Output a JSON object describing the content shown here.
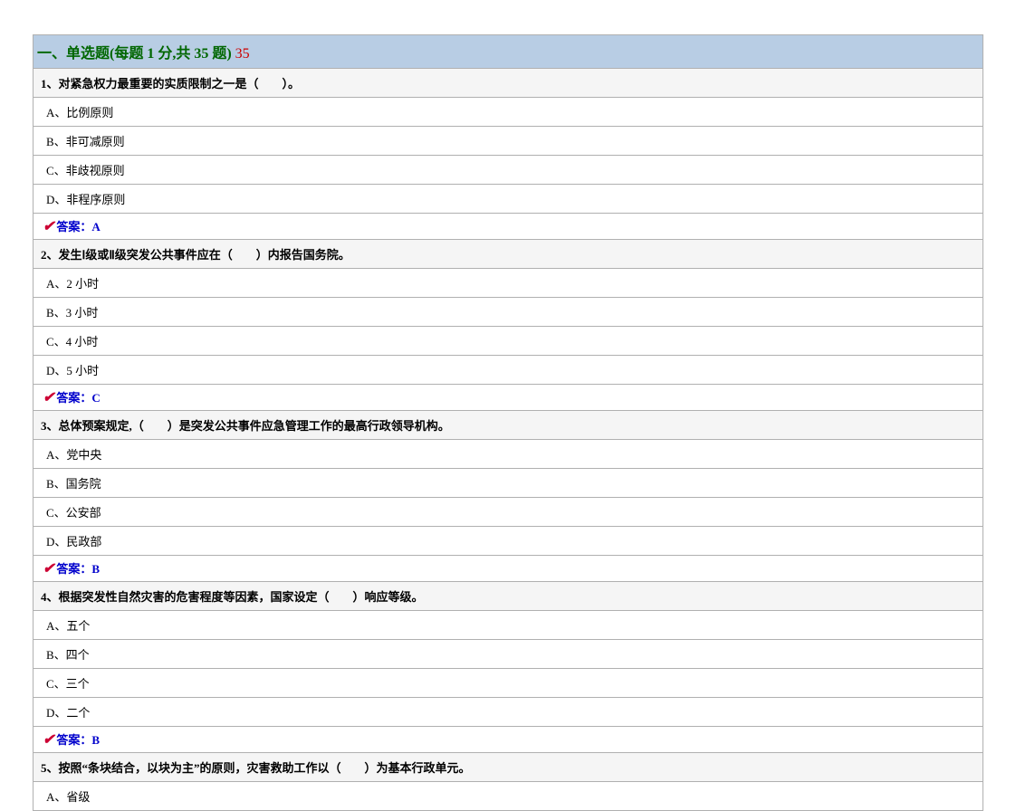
{
  "section": {
    "title": "一、单选题(每题 1 分,共 35 题)",
    "count": "35"
  },
  "questions": [
    {
      "stem": "1、对紧急权力最重要的实质限制之一是（　　）。",
      "options": [
        "A、比例原则",
        "B、非可减原则",
        "C、非歧视原则",
        "D、非程序原则"
      ],
      "answer_label": "答案：",
      "answer": "A"
    },
    {
      "stem": "2、发生Ⅰ级或Ⅱ级突发公共事件应在（　　）内报告国务院。",
      "options": [
        "A、2 小时",
        "B、3 小时",
        "C、4 小时",
        "D、5 小时"
      ],
      "answer_label": "答案：",
      "answer": "C"
    },
    {
      "stem": "3、总体预案规定,（　　）是突发公共事件应急管理工作的最高行政领导机构。",
      "options": [
        "A、党中央",
        "B、国务院",
        "C、公安部",
        "D、民政部"
      ],
      "answer_label": "答案：",
      "answer": "B"
    },
    {
      "stem": "4、根据突发性自然灾害的危害程度等因素，国家设定（　　）响应等级。",
      "options": [
        "A、五个",
        "B、四个",
        "C、三个",
        "D、二个"
      ],
      "answer_label": "答案：",
      "answer": "B"
    },
    {
      "stem": "5、按照“条块结合，以块为主”的原则，灾害救助工作以（　　）为基本行政单元。",
      "options": [
        "A、省级"
      ],
      "answer_label": "",
      "answer": ""
    }
  ]
}
